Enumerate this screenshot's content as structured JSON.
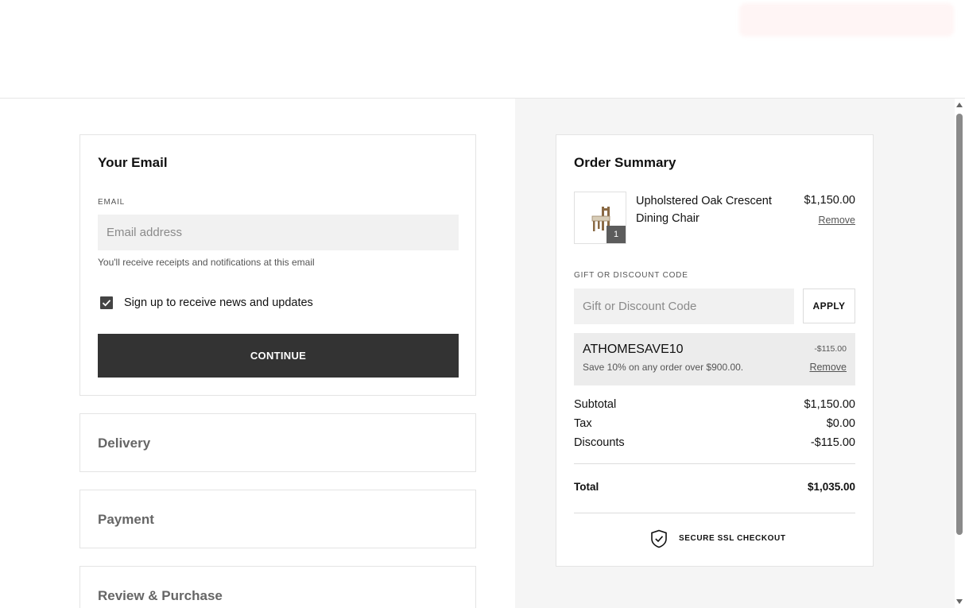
{
  "email_section": {
    "title": "Your Email",
    "field_label": "EMAIL",
    "placeholder": "Email address",
    "value": "",
    "hint": "You'll receive receipts and notifications at this email",
    "newsletter_label": "Sign up to receive news and updates",
    "newsletter_checked": true,
    "continue_label": "CONTINUE"
  },
  "steps": {
    "delivery": "Delivery",
    "payment": "Payment",
    "review": "Review & Purchase"
  },
  "order_summary": {
    "title": "Order Summary",
    "item": {
      "name": "Upholstered Oak Crescent Dining Chair",
      "price": "$1,150.00",
      "quantity": "1",
      "remove_label": "Remove"
    },
    "code_label": "GIFT OR DISCOUNT CODE",
    "code_placeholder": "Gift or Discount Code",
    "apply_label": "APPLY",
    "promo": {
      "code": "ATHOMESAVE10",
      "amount": "-$115.00",
      "description": "Save 10% on any order over $900.00.",
      "remove_label": "Remove"
    },
    "subtotal_label": "Subtotal",
    "subtotal": "$1,150.00",
    "tax_label": "Tax",
    "tax": "$0.00",
    "discounts_label": "Discounts",
    "discounts": "-$115.00",
    "total_label": "Total",
    "total": "$1,035.00",
    "secure_label": "SECURE SSL CHECKOUT"
  },
  "colors": {
    "button_dark": "#333333",
    "panel_bg": "#f5f5f5",
    "input_bg": "#f1f1f1"
  }
}
